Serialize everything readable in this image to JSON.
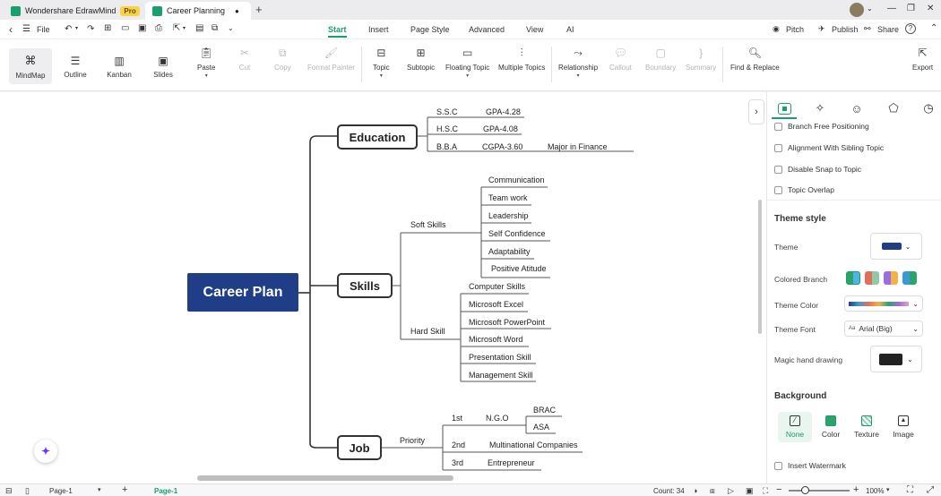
{
  "titlebar": {
    "app_tab": "Wondershare EdrawMind",
    "pro_badge": "Pro",
    "doc_tab": "Career Planning",
    "close_glyph": "●",
    "new_tab_glyph": "+",
    "minimize": "—",
    "restore": "❐",
    "close": "✕"
  },
  "menubar": {
    "back": "‹",
    "menu_icon": "☰",
    "file": "File",
    "tabs": [
      "Start",
      "Insert",
      "Page Style",
      "Advanced",
      "View",
      "AI"
    ],
    "active_tab": "Start",
    "right": {
      "pitch": "Pitch",
      "publish": "Publish",
      "share": "Share",
      "help": "?"
    }
  },
  "views": [
    "MindMap",
    "Outline",
    "Kanban",
    "Slides"
  ],
  "toolbar": {
    "paste": "Paste",
    "cut": "Cut",
    "copy": "Copy",
    "format_painter": "Format Painter",
    "topic": "Topic",
    "subtopic": "Subtopic",
    "floating_topic": "Floating Topic",
    "multiple_topics": "Multiple Topics",
    "relationship": "Relationship",
    "callout": "Callout",
    "boundary": "Boundary",
    "summary": "Summary",
    "find_replace": "Find & Replace",
    "export": "Export"
  },
  "mindmap": {
    "central": "Career Plan",
    "education": {
      "title": "Education",
      "rows": [
        {
          "level": "S.S.C",
          "gpa": "GPA-4.28"
        },
        {
          "level": "H.S.C",
          "gpa": "GPA-4.08"
        },
        {
          "level": "B.B.A",
          "gpa": "CGPA-3.60",
          "major": "Major in Finance"
        }
      ]
    },
    "skills": {
      "title": "Skills",
      "soft_label": "Soft Skills",
      "soft": [
        "Communication",
        "Team work",
        "Leadership",
        "Self Confidence",
        "Adaptability",
        "Positive Atitude"
      ],
      "hard_label": "Hard Skill",
      "hard": [
        "Computer Skills",
        "Microsoft Excel",
        "Microsoft PowerPoint",
        "Microsoft Word",
        "Presentation Skill",
        "Management Skill"
      ]
    },
    "job": {
      "title": "Job",
      "priority": "Priority",
      "p1": "1st",
      "ngo": "N.G.O",
      "brac": "BRAC",
      "asa": "ASA",
      "p2": "2nd",
      "mnc": "Multinational Companies",
      "p3": "3rd",
      "ent": "Entrepreneur"
    }
  },
  "panel": {
    "checkboxes": [
      "Branch Free Positioning",
      "Alignment With Sibling Topic",
      "Disable Snap to Topic",
      "Topic Overlap"
    ],
    "theme_style": "Theme style",
    "theme": "Theme",
    "colored_branch": "Colored Branch",
    "theme_color": "Theme Color",
    "theme_font": "Theme Font",
    "theme_font_value": "Arial (Big)",
    "magic": "Magic hand drawing",
    "background": "Background",
    "bg_options": [
      "None",
      "Color",
      "Texture",
      "Image"
    ],
    "insert_watermark": "Insert Watermark"
  },
  "statusbar": {
    "page_select": "Page-1",
    "page_tab": "Page-1",
    "count": "Count: 34",
    "zoom": "100%"
  },
  "colors": {
    "accent": "#1a9e6e",
    "central_fill": "#1f3e87"
  }
}
